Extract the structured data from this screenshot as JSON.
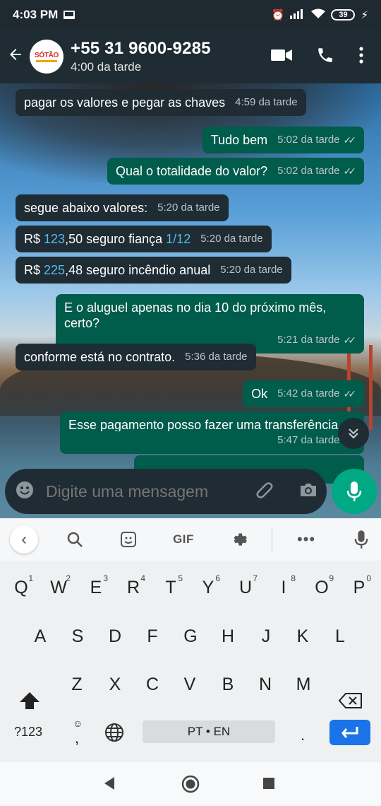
{
  "status_bar": {
    "time": "4:03 PM",
    "battery": "39",
    "icons": [
      "screen-icon",
      "alarm-icon",
      "signal-icon",
      "wifi-icon",
      "battery-icon",
      "charging-icon"
    ]
  },
  "header": {
    "contact_name": "+55 31 9600-9285",
    "status": "4:00 da tarde",
    "avatar_text": "SÓTÃO",
    "icons": [
      "back-arrow-icon",
      "video-call-icon",
      "phone-call-icon",
      "more-vert-icon"
    ]
  },
  "messages": [
    {
      "dir": "in",
      "text": "pagar os valores e pegar as chaves",
      "time": "4:59 da tarde"
    },
    {
      "dir": "out",
      "text": "Tudo bem",
      "time": "5:02 da tarde",
      "read": true
    },
    {
      "dir": "out",
      "text": "Qual o totalidade do valor?",
      "time": "5:02 da tarde",
      "read": true
    },
    {
      "dir": "in",
      "text": "segue abaixo valores:",
      "time": "5:20 da tarde"
    },
    {
      "dir": "in",
      "parts": [
        "R$ ",
        "123",
        ",50 seguro fiança ",
        "1/12"
      ],
      "time": "5:20 da tarde"
    },
    {
      "dir": "in",
      "parts": [
        "R$ ",
        "225",
        ",48 seguro incêndio anual"
      ],
      "time": "5:20 da tarde"
    },
    {
      "dir": "out",
      "text": "E o aluguel apenas no dia 10 do próximo mês, certo?",
      "time": "5:21 da tarde",
      "read": true
    },
    {
      "dir": "in",
      "text": "conforme está no contrato.",
      "time": "5:36 da tarde"
    },
    {
      "dir": "out",
      "text": "Ok",
      "time": "5:42 da tarde",
      "read": true
    },
    {
      "dir": "out",
      "text": "Esse pagamento posso fazer uma transferência",
      "time": "5:47 da tarde",
      "read": true
    }
  ],
  "input": {
    "placeholder": "Digite uma mensagem"
  },
  "keyboard": {
    "toolbar": {
      "gif": "GIF"
    },
    "row1": [
      "Q",
      "W",
      "E",
      "R",
      "T",
      "Y",
      "U",
      "I",
      "O",
      "P"
    ],
    "row1_hints": [
      "1",
      "2",
      "3",
      "4",
      "5",
      "6",
      "7",
      "8",
      "9",
      "0"
    ],
    "row2": [
      "A",
      "S",
      "D",
      "F",
      "G",
      "H",
      "J",
      "K",
      "L"
    ],
    "row3": [
      "Z",
      "X",
      "C",
      "V",
      "B",
      "N",
      "M"
    ],
    "symbols_key": "?123",
    "comma_key": ",",
    "comma_hint": "☺",
    "space_label": "PT • EN",
    "period_key": "."
  },
  "colors": {
    "header_bg": "#1f2c34",
    "incoming_bubble": "#1f2c34",
    "outgoing_bubble": "#005c4b",
    "mic_button": "#00a884",
    "link_blue": "#53bdeb",
    "enter_key": "#1a73e8"
  }
}
